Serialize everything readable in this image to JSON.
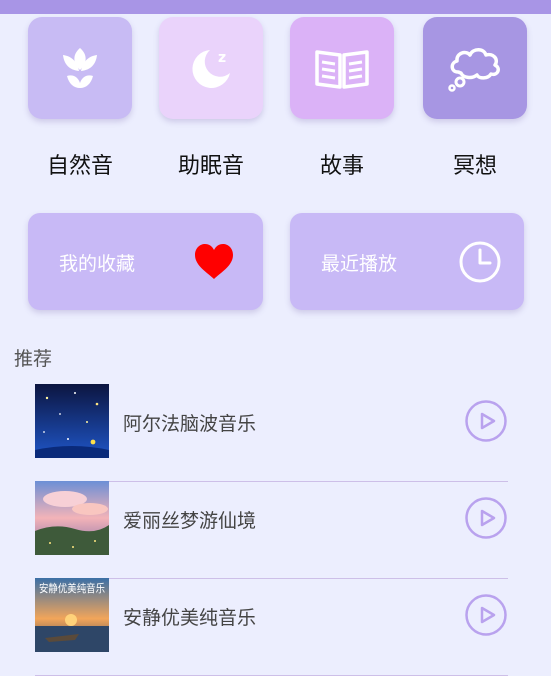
{
  "categories": [
    {
      "label": "自然音",
      "icon": "flower-icon",
      "color": "#c8bbf4"
    },
    {
      "label": "助眠音",
      "icon": "moon-icon",
      "color": "#ead3fb"
    },
    {
      "label": "故事",
      "icon": "book-icon",
      "color": "#dbb2f7"
    },
    {
      "label": "冥想",
      "icon": "cloud-icon",
      "color": "#a796e3"
    }
  ],
  "quick": {
    "favorites_label": "我的收藏",
    "recent_label": "最近播放"
  },
  "recommend": {
    "title": "推荐",
    "items": [
      {
        "title": "阿尔法脑波音乐"
      },
      {
        "title": "爱丽丝梦游仙境"
      },
      {
        "title": "安静优美纯音乐",
        "cover_text": "安静优美纯音乐"
      }
    ]
  },
  "colors": {
    "accent": "#a895e6",
    "card": "#c8b9f6",
    "heart": "#ff0000",
    "play": "#b9a2ee",
    "background": "#eceefe"
  }
}
